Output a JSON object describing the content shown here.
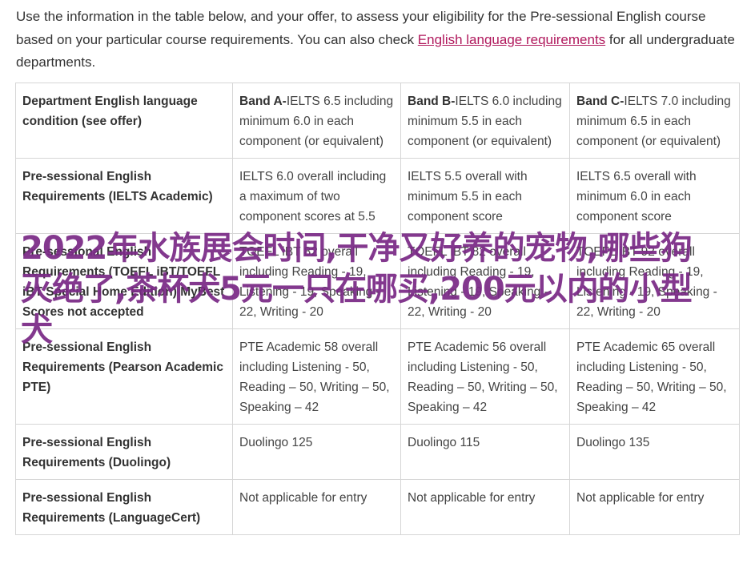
{
  "intro": {
    "text_before_link": "Use the information in the table below, and your offer, to assess your eligibility for the Pre-sessional English course based on your particular course requirements. You can also check ",
    "link_text": "English language requirements",
    "text_after_link": " for all undergraduate departments."
  },
  "table": {
    "header_row": {
      "label": "Department English language condition (see offer)",
      "bands": [
        {
          "name": "Band A-",
          "detail": "IELTS 6.5 including minimum 6.0 in each component (or equivalent)"
        },
        {
          "name": "Band B-",
          "detail": "IELTS 6.0 including minimum 5.5 in each component (or equivalent)"
        },
        {
          "name": "Band C-",
          "detail": "IELTS 7.0 including minimum 6.5 in each component (or equivalent)"
        }
      ]
    },
    "rows": [
      {
        "label": "Pre-sessional English Requirements (IELTS Academic)",
        "cells": [
          "IELTS 6.0 overall including a maximum of two component scores at 5.5",
          "IELTS 5.5 overall with minimum 5.5 in each component score",
          "IELTS 6.5 overall with minimum 6.0 in each component score"
        ]
      },
      {
        "label": "Pre-sessional English Requirements (TOEFL iBT/TOEFL iBT Special Home Edition) MyBest Scores not accepted",
        "cells": [
          "TOEFL iBT 82 overall including Reading - 19, Listening - 19, Speaking - 22, Writing - 20",
          "TOEFL iBT 82 overall including Reading - 19, Listening - 19, Speaking - 22, Writing - 20",
          "TOEFL iBT 92 overall including Reading - 19, Listening - 19, Speaking - 22, Writing - 20"
        ]
      },
      {
        "label": "Pre-sessional English Requirements (Pearson Academic PTE)",
        "cells": [
          "PTE Academic 58 overall including Listening - 50, Reading – 50, Writing – 50, Speaking – 42",
          "PTE Academic 56 overall including Listening - 50, Reading – 50, Writing – 50, Speaking – 42",
          "PTE Academic 65 overall including Listening - 50, Reading – 50, Writing – 50, Speaking – 42"
        ]
      },
      {
        "label": "Pre-sessional English Requirements (Duolingo)",
        "cells": [
          "Duolingo 125",
          "Duolingo 115",
          "Duolingo 135"
        ]
      },
      {
        "label": "Pre-sessional English Requirements (LanguageCert)",
        "cells": [
          "Not applicable for entry",
          "Not applicable for entry",
          "Not applicable for entry"
        ]
      }
    ]
  },
  "watermark": {
    "text": "2022年水族展会时间,干净又好养的宠物,哪些狗灭绝了,茶杯犬5元一只在哪买,200元以内的小型犬"
  },
  "colors": {
    "link": "#b0185c",
    "watermark": "#7a2a86",
    "border": "#d6d6d6"
  }
}
